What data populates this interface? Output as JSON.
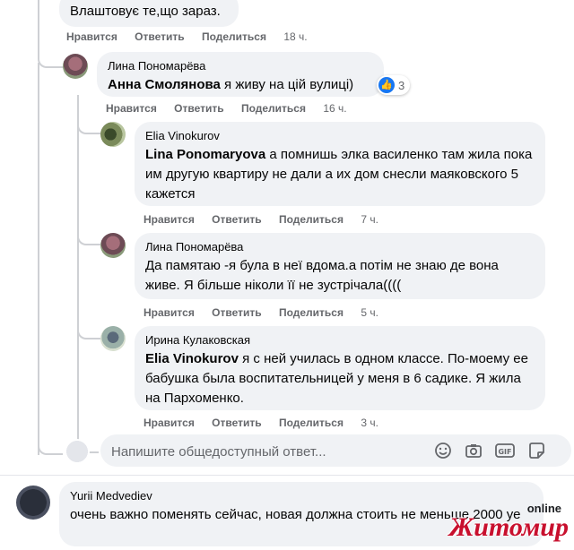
{
  "top_comment": {
    "text": "Влаштовує те,що зараз.",
    "actions": {
      "like": "Нравится",
      "reply": "Ответить",
      "share": "Поделиться",
      "time": "18 ч."
    }
  },
  "reply1": {
    "author": "Лина Пономарёва",
    "mention": "Анна Смолянова",
    "text": " я живу на цій вулиці)",
    "reaction_count": "3",
    "actions": {
      "like": "Нравится",
      "reply": "Ответить",
      "share": "Поделиться",
      "time": "16 ч."
    }
  },
  "reply2": {
    "author": "Elia Vinokurov",
    "mention": "Lina Ponomaryova",
    "text": " а помнишь элка василенко там жила пока им другую квартиру не дали а их дом снесли маяковского 5 кажется",
    "actions": {
      "like": "Нравится",
      "reply": "Ответить",
      "share": "Поделиться",
      "time": "7 ч."
    }
  },
  "reply3": {
    "author": "Лина Пономарёва",
    "text": "Да памятаю -я була в неї вдома.а потім не знаю де вона живе. Я більше ніколи її не зустрічала((((",
    "actions": {
      "like": "Нравится",
      "reply": "Ответить",
      "share": "Поделиться",
      "time": "5 ч."
    }
  },
  "reply4": {
    "author": "Ирина Кулаковская",
    "mention": "Elia Vinokurov",
    "text": " я с ней училась в одном классе. По-моему ее бабушка была воспитательницей у меня в 6 садике. Я жила на Пархоменко.",
    "actions": {
      "like": "Нравится",
      "reply": "Ответить",
      "share": "Поделиться",
      "time": "3 ч."
    }
  },
  "reply_box": {
    "placeholder": "Напишите общедоступный ответ...",
    "icons": [
      "emoji-icon",
      "camera-icon",
      "gif-icon",
      "sticker-icon"
    ]
  },
  "comment2": {
    "author": "Yurii Medvediev",
    "text": "очень важно поменять сейчас, новая должна стоить не меньше 2000 уе"
  },
  "watermark": {
    "top": "online",
    "main": "Житомир"
  },
  "colors": {
    "bubble": "#f0f2f5",
    "meta": "#65676b",
    "like_blue": "#1877f2",
    "watermark_red": "#c8102e"
  }
}
